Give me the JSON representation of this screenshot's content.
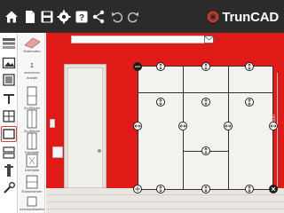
{
  "app": {
    "brand_name": "TrunCAD",
    "accent_color": "#e53935",
    "toolbar_color": "#2b2b2b",
    "wall_color": "#e01a16"
  },
  "toolbar": {
    "icons": [
      "home-icon",
      "new-file-icon",
      "save-icon",
      "settings-icon",
      "help-icon",
      "share-icon",
      "undo-icon",
      "redo-icon"
    ]
  },
  "sidebar": {
    "icons": [
      "materials-icon",
      "image-icon",
      "panel-icon",
      "shelf-icon",
      "divider-icon",
      "front-icon",
      "drawer-icon",
      "hardware-icon",
      "tool-icon"
    ],
    "active": "front-icon"
  },
  "palette": {
    "items": [
      {
        "label": "Eckfronten"
      },
      {
        "label": "Anzahl",
        "value": "1"
      },
      {
        "label": "Zu-Blöcke"
      },
      {
        "label": "Zu-Blöcke"
      },
      {
        "label": "Drehfalte"
      },
      {
        "label": "Drehfalte"
      },
      {
        "label": "Eckscharnier"
      },
      {
        "label": "Innenaufbauten"
      }
    ]
  },
  "scene": {
    "dimension_label": "2800"
  }
}
